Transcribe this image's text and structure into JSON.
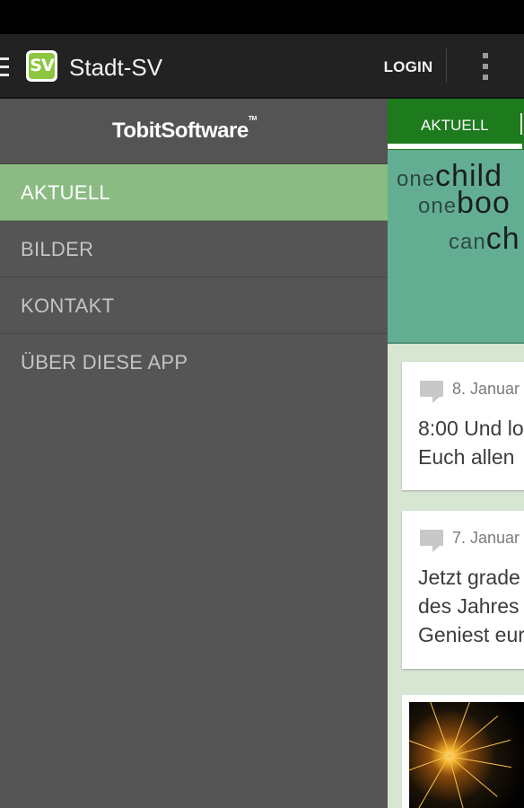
{
  "app": {
    "title": "Stadt-SV",
    "logo_text": "SV",
    "login_label": "LOGIN"
  },
  "drawer": {
    "brand": "TobitSoftware",
    "brand_tm": "TM",
    "items": [
      {
        "label": "AKTUELL",
        "active": true
      },
      {
        "label": "BILDER",
        "active": false
      },
      {
        "label": "KONTAKT",
        "active": false
      },
      {
        "label": "ÜBER DIESE APP",
        "active": false
      }
    ]
  },
  "content": {
    "tab": "AKTUELL",
    "banner": {
      "line1_light": "one",
      "line1_heavy": "child",
      "line2_light": "one",
      "line2_heavy": "boo",
      "line3_light": "can",
      "line3_heavy": "ch"
    },
    "posts": [
      {
        "date": "8. Januar",
        "lines": [
          "8:00 Und lo",
          "Euch allen"
        ]
      },
      {
        "date": "7. Januar",
        "lines": [
          "Jetzt grade",
          "des Jahres",
          "Geniest eur"
        ]
      }
    ]
  },
  "colors": {
    "action_bar": "#222222",
    "drawer_bg": "#555555",
    "drawer_active": "#8bbb83",
    "tab_bar": "#1d7a1d",
    "banner": "#63ae93",
    "logo_green": "#8cc63f"
  },
  "icons": [
    "hamburger-icon",
    "app-logo-icon",
    "overflow-menu-icon",
    "comment-icon"
  ]
}
